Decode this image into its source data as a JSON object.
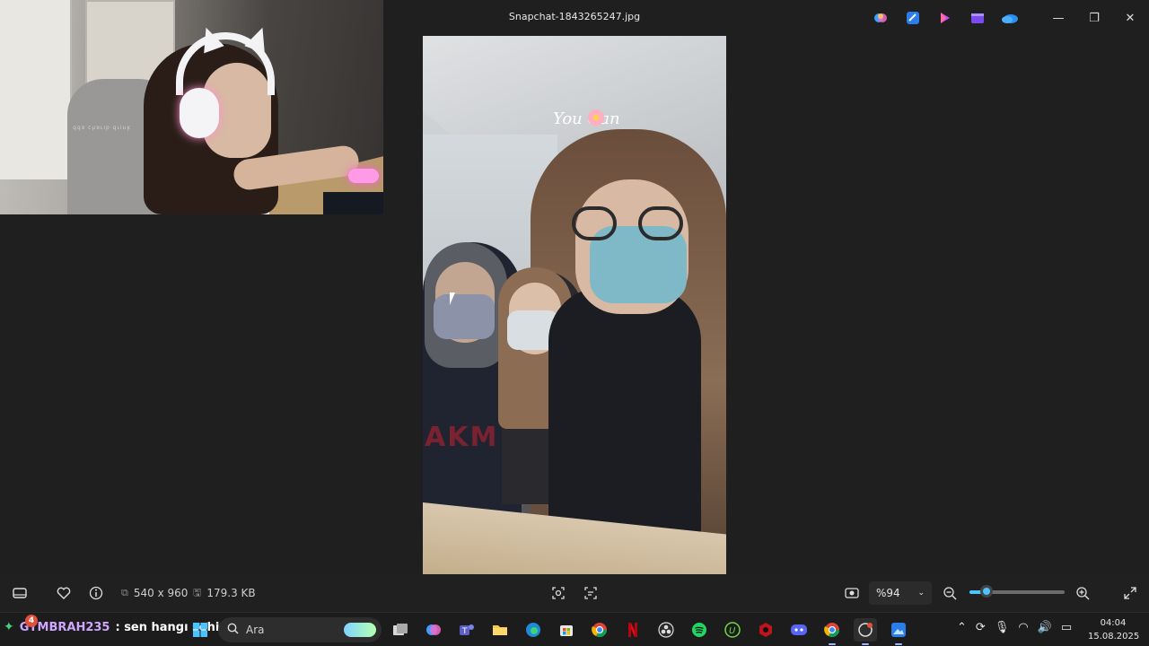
{
  "window": {
    "title": "Snapchat-1843265247.jpg",
    "controls": {
      "minimize": "—",
      "maximize": "❐",
      "close": "✕"
    }
  },
  "header_app_icons": [
    "copilot-icon",
    "photos-editor-icon",
    "designer-icon",
    "clipchamp-icon",
    "onedrive-icon"
  ],
  "webcam": {
    "sticker_text": "ʞuiɹp qıɹɐɥɔ ɐpp"
  },
  "photo": {
    "overlay_text": "You Can",
    "shirt_text": "AKM"
  },
  "viewer_bar": {
    "dimensions": "540 x 960",
    "file_size": "179.3 KB",
    "zoom_label": "%94",
    "zoom_fraction": 0.18
  },
  "taskbar": {
    "chat_badge": "4",
    "chat_user": "GYMBRAH235",
    "chat_message": ": sen hangı sehirde oturuyon",
    "search_placeholder": "Ara",
    "time": "04:04",
    "date": "15.08.2025"
  },
  "colors": {
    "accent": "#4cc2ff",
    "background": "#1f1f1f",
    "taskbar": "#1c1c1c"
  }
}
